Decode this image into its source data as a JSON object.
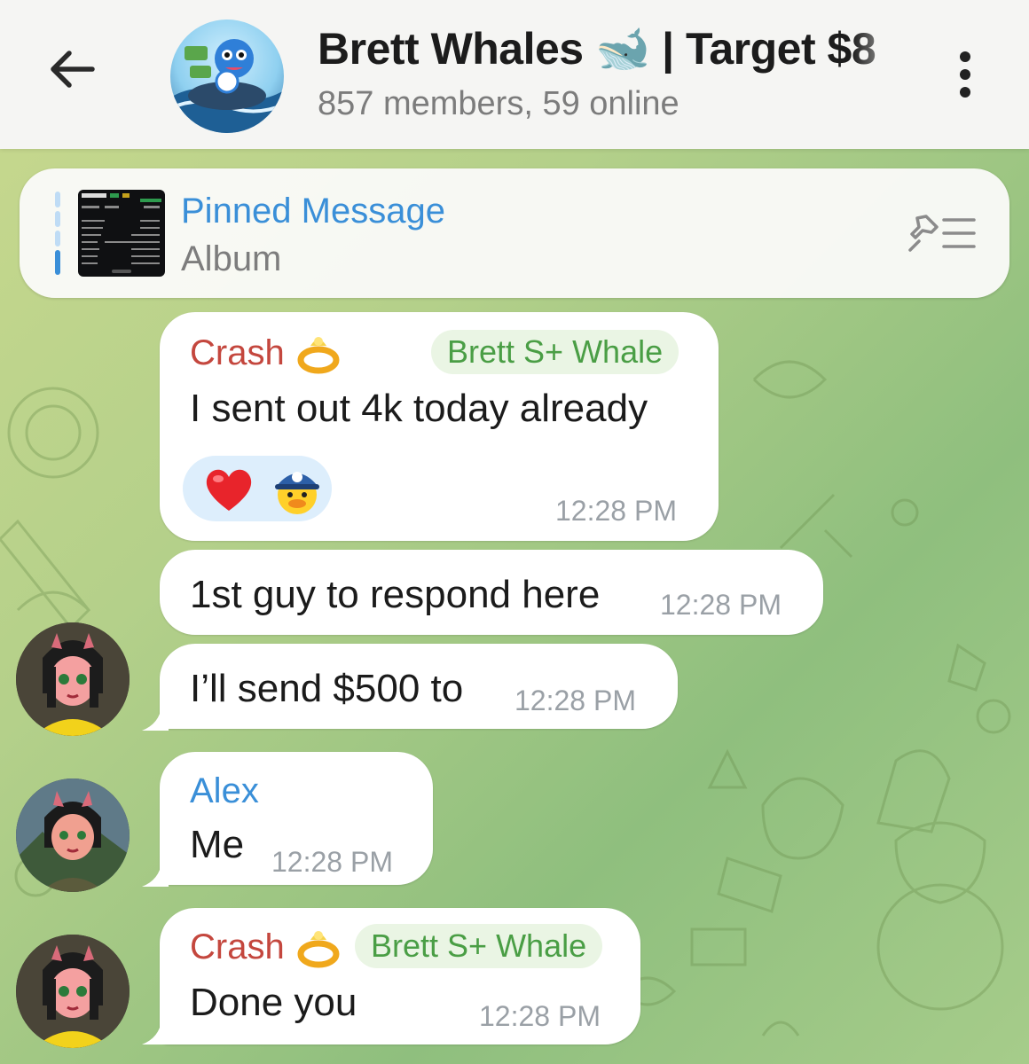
{
  "header": {
    "title": "Brett Whales 🐋 | Target $8",
    "subtitle": "857 members, 59 online",
    "back_icon": "arrow-left-icon",
    "menu_icon": "more-vertical-icon"
  },
  "pinned": {
    "title": "Pinned Message",
    "subtitle": "Album",
    "icon": "pin-list-icon"
  },
  "messages": [
    {
      "sender": "Crash",
      "badge": "Brett S+ Whale",
      "text": "I sent out 4k today already",
      "time": "12:28 PM",
      "reactions": [
        "heart",
        "duck-cap"
      ]
    },
    {
      "text": "1st guy to respond here",
      "time": "12:28 PM"
    },
    {
      "text": "I’ll send $500 to",
      "time": "12:28 PM"
    },
    {
      "sender": "Alex",
      "text": "Me",
      "time": "12:28 PM"
    },
    {
      "sender": "Crash",
      "badge": "Brett S+ Whale",
      "text": "Done you",
      "time": "12:28 PM"
    }
  ],
  "colors": {
    "accent_blue": "#3a8fd8",
    "sender_red": "#c4473e",
    "badge_green": "#4a9e45",
    "badge_bg": "#eaf5e4"
  }
}
